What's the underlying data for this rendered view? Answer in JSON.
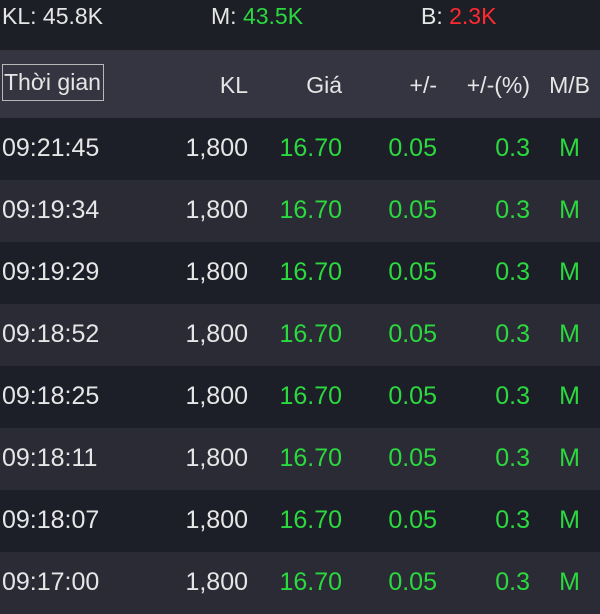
{
  "summary": {
    "kl_label": "KL:",
    "kl_value": "45.8K",
    "m_label": "M:",
    "m_value": "43.5K",
    "b_label": "B:",
    "b_value": "2.3K"
  },
  "columns": {
    "time": "Thời gian",
    "volume": "KL",
    "price": "Giá",
    "change": "+/-",
    "change_pct": "+/-(%)",
    "side": "M/B"
  },
  "rows": [
    {
      "time": "09:21:45",
      "volume": "1,800",
      "price": "16.70",
      "change": "0.05",
      "change_pct": "0.3",
      "side": "M"
    },
    {
      "time": "09:19:34",
      "volume": "1,800",
      "price": "16.70",
      "change": "0.05",
      "change_pct": "0.3",
      "side": "M"
    },
    {
      "time": "09:19:29",
      "volume": "1,800",
      "price": "16.70",
      "change": "0.05",
      "change_pct": "0.3",
      "side": "M"
    },
    {
      "time": "09:18:52",
      "volume": "1,800",
      "price": "16.70",
      "change": "0.05",
      "change_pct": "0.3",
      "side": "M"
    },
    {
      "time": "09:18:25",
      "volume": "1,800",
      "price": "16.70",
      "change": "0.05",
      "change_pct": "0.3",
      "side": "M"
    },
    {
      "time": "09:18:11",
      "volume": "1,800",
      "price": "16.70",
      "change": "0.05",
      "change_pct": "0.3",
      "side": "M"
    },
    {
      "time": "09:18:07",
      "volume": "1,800",
      "price": "16.70",
      "change": "0.05",
      "change_pct": "0.3",
      "side": "M"
    },
    {
      "time": "09:17:00",
      "volume": "1,800",
      "price": "16.70",
      "change": "0.05",
      "change_pct": "0.3",
      "side": "M"
    }
  ],
  "colors": {
    "up": "#2bd93f",
    "down": "#ff2a2f",
    "background": "#1d1f27",
    "header_background": "#343541"
  }
}
